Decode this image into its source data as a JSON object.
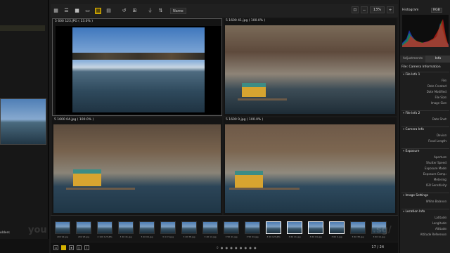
{
  "toolbar": {
    "sort_label": "Name",
    "zoom_value": "13%"
  },
  "captions": [
    "5 600 123.JPG ( 13.0% )",
    "5 1600 41.jpg ( 100.0% )",
    "5 1600 04.jpg ( 100.0% )",
    "5 1600 9.jpg ( 100.0% )"
  ],
  "left_panel": {
    "folders_label": "olders"
  },
  "filmstrip": {
    "labels": [
      "200 92.jpg",
      "202 93.jpg",
      "2 100 123.JPG",
      "3 40 41.jpg",
      "3 40 04.jpg",
      "3 4 0 9.jpg",
      "3 40 38.jpg",
      "3 40 14.jpg",
      "3 50 41.jpg",
      "3 50 04.jpg",
      "3 60 123.JPG",
      "3 60 41.jpg",
      "3 60 04.jpg",
      "3 60 9.jpg",
      "3 60 38.jpg",
      "3 60 14.jpg"
    ],
    "selected": [
      10,
      11,
      12,
      13
    ]
  },
  "bottom": {
    "page": "17 / 24"
  },
  "right_panel": {
    "histogram_label": "Histogram",
    "histogram_mode": "RGB",
    "tabs": [
      "Adjustments",
      "Info"
    ],
    "active_tab": 1,
    "camera_info": "File: Camera Information",
    "sections": [
      {
        "title": "File Info 1",
        "fields": [
          "File:",
          "Date Created:",
          "Date Modified:",
          "File Size:",
          "Image Size:"
        ]
      },
      {
        "title": "File Info 2",
        "fields": [
          "Date Shot:"
        ]
      },
      {
        "title": "Camera Info",
        "fields": [
          "Device:",
          "Focal Length:"
        ]
      },
      {
        "title": "Exposure",
        "fields": [
          "Aperture:",
          "Shutter Speed:",
          "Exposure Mode:",
          "Exposure Comp.:",
          "Metering:",
          "ISO Sensitivity:"
        ]
      },
      {
        "title": "Image Settings",
        "fields": [
          "White Balance:"
        ]
      },
      {
        "title": "Location Info",
        "fields": [
          "Latitude:",
          "Longitude:",
          "Altitude:",
          "Altitude Reference:"
        ]
      }
    ]
  }
}
